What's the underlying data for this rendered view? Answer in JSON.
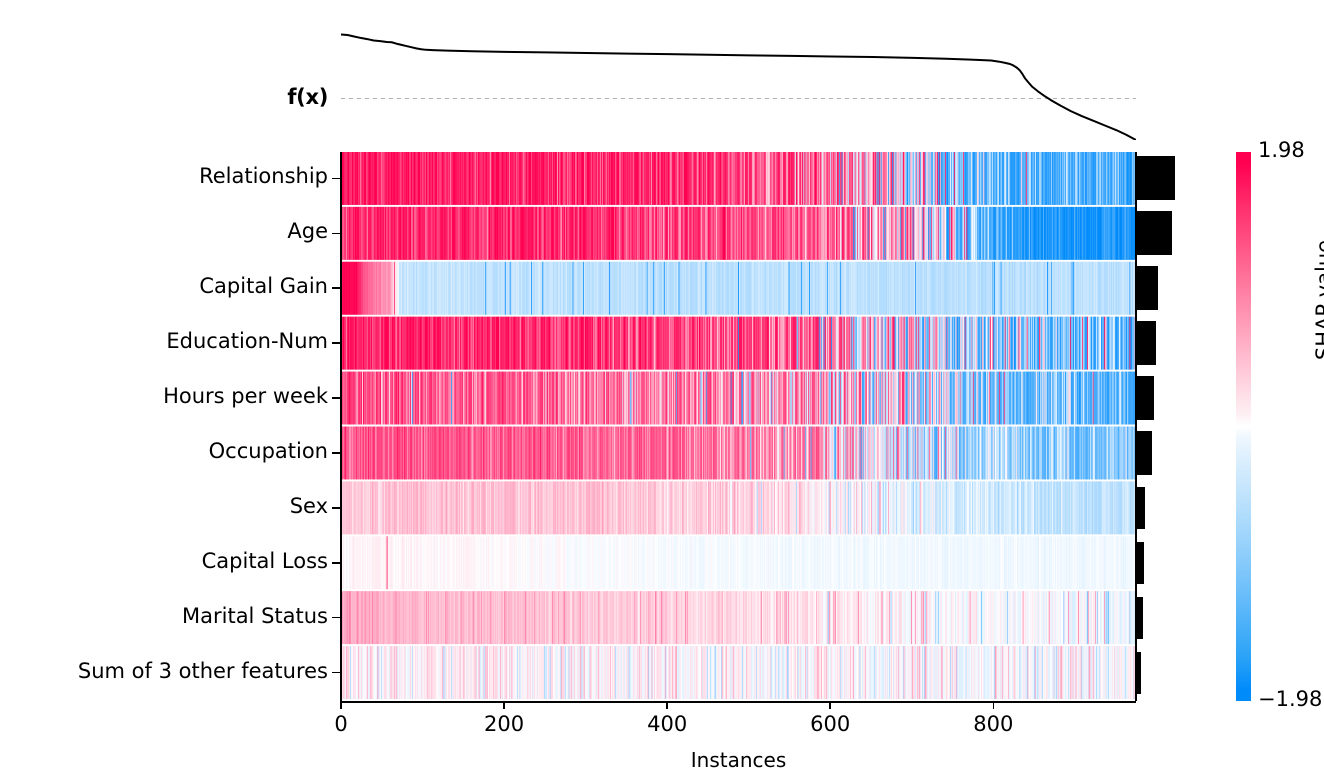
{
  "chart_data": {
    "type": "heatmap",
    "title": "",
    "xlabel": "Instances",
    "ylabel": "",
    "colorbar_label": "SHAP value",
    "colorbar_max": "1.98",
    "colorbar_min": "−1.98",
    "colorbar_max_value": 1.98,
    "colorbar_min_value": -1.98,
    "color_high": "#ff0051",
    "color_mid": "#ffffff",
    "color_low": "#008bfb",
    "fx_label": "f(x)",
    "n_instances": 975,
    "xlim": [
      0,
      975
    ],
    "xticks": [
      0,
      200,
      400,
      600,
      800
    ],
    "xticklabels": [
      "0",
      "200",
      "400",
      "600",
      "800"
    ],
    "grid": false,
    "legend": "none",
    "features": [
      "Relationship",
      "Age",
      "Capital Gain",
      "Education-Num",
      "Hours per week",
      "Occupation",
      "Sex",
      "Capital Loss",
      "Marital Status",
      "Sum of 3 other features"
    ],
    "importance_bar_lengths": [
      39,
      36,
      22,
      20,
      18,
      16,
      9,
      8,
      7,
      5
    ],
    "fx_curve": [
      [
        0,
        36
      ],
      [
        8,
        38
      ],
      [
        16,
        43
      ],
      [
        24,
        48
      ],
      [
        32,
        52
      ],
      [
        40,
        57
      ],
      [
        48,
        59
      ],
      [
        56,
        62
      ],
      [
        62,
        63
      ],
      [
        68,
        68
      ],
      [
        74,
        72
      ],
      [
        80,
        76
      ],
      [
        86,
        80
      ],
      [
        92,
        84
      ],
      [
        98,
        87
      ],
      [
        104,
        89
      ],
      [
        112,
        90
      ],
      [
        130,
        92
      ],
      [
        160,
        94
      ],
      [
        200,
        96
      ],
      [
        250,
        98
      ],
      [
        300,
        100
      ],
      [
        350,
        102
      ],
      [
        400,
        104
      ],
      [
        450,
        106
      ],
      [
        500,
        108
      ],
      [
        550,
        110
      ],
      [
        600,
        112
      ],
      [
        650,
        114
      ],
      [
        700,
        117
      ],
      [
        740,
        120
      ],
      [
        770,
        123
      ],
      [
        795,
        126
      ],
      [
        805,
        130
      ],
      [
        812,
        134
      ],
      [
        818,
        138
      ],
      [
        822,
        143
      ],
      [
        826,
        150
      ],
      [
        830,
        160
      ],
      [
        833,
        172
      ],
      [
        836,
        186
      ],
      [
        840,
        200
      ],
      [
        845,
        216
      ],
      [
        852,
        232
      ],
      [
        860,
        248
      ],
      [
        870,
        266
      ],
      [
        880,
        282
      ],
      [
        892,
        300
      ],
      [
        906,
        318
      ],
      [
        920,
        334
      ],
      [
        934,
        350
      ],
      [
        948,
        366
      ],
      [
        960,
        382
      ],
      [
        972,
        400
      ]
    ],
    "rows": [
      {
        "feature": "Relationship",
        "description": "dense crimson/pink stripes on left, shifting to light blue on right",
        "base_gradient": [
          [
            0.0,
            1.0
          ],
          [
            0.45,
            0.72
          ],
          [
            0.62,
            0.35
          ],
          [
            0.78,
            -0.3
          ],
          [
            0.9,
            -0.52
          ],
          [
            1.0,
            -0.58
          ]
        ],
        "noise": 0.62,
        "spike_density": 0.3,
        "spike_strength": 0.95
      },
      {
        "feature": "Age",
        "description": "pink left half, strong saturated blue at far right",
        "base_gradient": [
          [
            0.0,
            0.8
          ],
          [
            0.3,
            0.78
          ],
          [
            0.55,
            0.55
          ],
          [
            0.72,
            0.1
          ],
          [
            0.85,
            -0.7
          ],
          [
            0.93,
            -1.0
          ],
          [
            1.0,
            -1.0
          ]
        ],
        "noise": 0.55,
        "spike_density": 0.26,
        "spike_strength": 0.92
      },
      {
        "feature": "Capital Gain",
        "description": "solid crimson block at far left then uniform pale blue",
        "base_gradient": [
          [
            0.0,
            1.0
          ],
          [
            0.018,
            1.0
          ],
          [
            0.03,
            0.55
          ],
          [
            0.06,
            0.3
          ],
          [
            0.075,
            -0.16
          ],
          [
            0.5,
            -0.18
          ],
          [
            1.0,
            -0.18
          ]
        ],
        "noise": 0.1,
        "spike_density": 0.035,
        "spike_strength": 0.98
      },
      {
        "feature": "Education-Num",
        "description": "strong pink left two thirds, pale blue on right",
        "base_gradient": [
          [
            0.0,
            0.92
          ],
          [
            0.2,
            0.8
          ],
          [
            0.45,
            0.62
          ],
          [
            0.62,
            0.3
          ],
          [
            0.78,
            -0.18
          ],
          [
            0.9,
            -0.3
          ],
          [
            1.0,
            -0.3
          ]
        ],
        "noise": 0.62,
        "spike_density": 0.3,
        "spike_strength": 0.92
      },
      {
        "feature": "Hours per week",
        "description": "light pink with many white gaps, blue-ish right end",
        "base_gradient": [
          [
            0.0,
            0.55
          ],
          [
            0.25,
            0.42
          ],
          [
            0.5,
            0.3
          ],
          [
            0.7,
            0.05
          ],
          [
            0.85,
            -0.35
          ],
          [
            1.0,
            -0.5
          ]
        ],
        "noise": 0.58,
        "spike_density": 0.26,
        "spike_strength": 0.8
      },
      {
        "feature": "Occupation",
        "description": "medium pink left, pale blue right",
        "base_gradient": [
          [
            0.0,
            0.6
          ],
          [
            0.3,
            0.52
          ],
          [
            0.52,
            0.34
          ],
          [
            0.7,
            -0.05
          ],
          [
            0.86,
            -0.28
          ],
          [
            1.0,
            -0.34
          ]
        ],
        "noise": 0.4,
        "spike_density": 0.22,
        "spike_strength": 0.7
      },
      {
        "feature": "Sex",
        "description": "very faint pink left, faint blue right",
        "base_gradient": [
          [
            0.0,
            0.16
          ],
          [
            0.35,
            0.14
          ],
          [
            0.58,
            0.06
          ],
          [
            0.75,
            -0.08
          ],
          [
            1.0,
            -0.18
          ]
        ],
        "noise": 0.13,
        "spike_density": 0.1,
        "spike_strength": 0.3
      },
      {
        "feature": "Capital Loss",
        "description": "near white with isolated crimson stripes at far left",
        "base_gradient": [
          [
            0.0,
            0.01
          ],
          [
            0.02,
            0.02
          ],
          [
            0.08,
            0.02
          ],
          [
            0.5,
            -0.02
          ],
          [
            1.0,
            -0.03
          ]
        ],
        "noise": 0.035,
        "spike_density": 0.02,
        "spike_strength": 1.0,
        "spike_cluster": [
          0.018,
          0.075
        ]
      },
      {
        "feature": "Marital Status",
        "description": "pale pink left fading to near white right",
        "base_gradient": [
          [
            0.0,
            0.22
          ],
          [
            0.2,
            0.17
          ],
          [
            0.45,
            0.09
          ],
          [
            0.7,
            0.02
          ],
          [
            1.0,
            -0.03
          ]
        ],
        "noise": 0.1,
        "spike_density": 0.08,
        "spike_strength": 0.45
      },
      {
        "feature": "Sum of 3 other features",
        "description": "very faint mixed pink and blue stripes throughout",
        "base_gradient": [
          [
            0.0,
            0.03
          ],
          [
            0.3,
            0.02
          ],
          [
            0.6,
            0.0
          ],
          [
            1.0,
            -0.01
          ]
        ],
        "noise": 0.12,
        "spike_density": 0.14,
        "spike_strength": 0.28
      }
    ]
  }
}
